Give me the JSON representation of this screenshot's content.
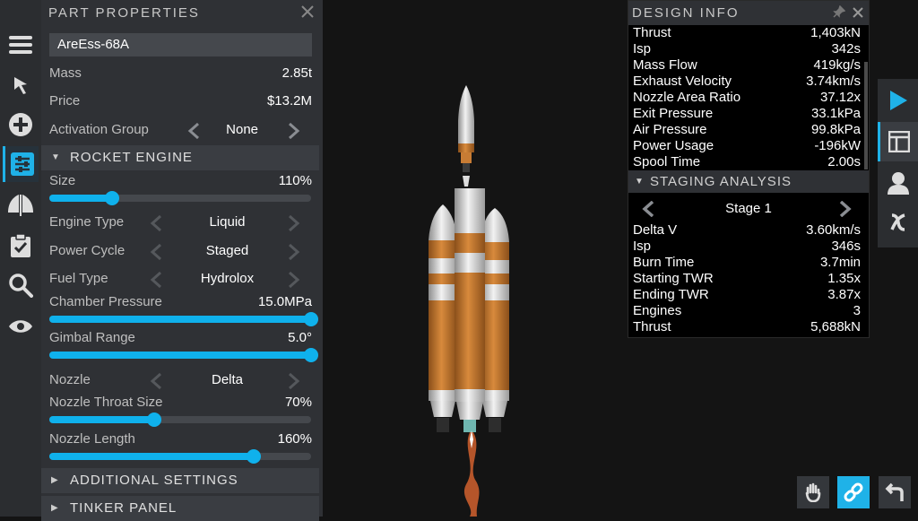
{
  "toolbar": {
    "icons": [
      "menu-icon",
      "cursor-icon",
      "add-part-icon",
      "part-properties-icon",
      "symmetry-icon",
      "checklist-icon",
      "search-icon",
      "visibility-icon"
    ]
  },
  "part_properties": {
    "title": "PART PROPERTIES",
    "part_name": "AreEss-68A",
    "mass_label": "Mass",
    "mass_value": "2.85t",
    "price_label": "Price",
    "price_value": "$13.2M",
    "activation_label": "Activation Group",
    "activation_value": "None",
    "rocket_engine_title": "ROCKET ENGINE",
    "size_label": "Size",
    "size_value": "110%",
    "size_level": 0.24,
    "engine_type_label": "Engine Type",
    "engine_type_value": "Liquid",
    "power_cycle_label": "Power Cycle",
    "power_cycle_value": "Staged",
    "fuel_type_label": "Fuel Type",
    "fuel_type_value": "Hydrolox",
    "chamber_label": "Chamber Pressure",
    "chamber_value": "15.0MPa",
    "chamber_level": 1.0,
    "gimbal_label": "Gimbal Range",
    "gimbal_value": "5.0°",
    "gimbal_level": 1.0,
    "nozzle_label": "Nozzle",
    "nozzle_value": "Delta",
    "throat_label": "Nozzle Throat Size",
    "throat_value": "70%",
    "throat_level": 0.4,
    "length_label": "Nozzle Length",
    "length_value": "160%",
    "length_level": 0.78,
    "additional_title": "ADDITIONAL SETTINGS",
    "tinker_title": "TINKER PANEL"
  },
  "design_info": {
    "title": "DESIGN INFO",
    "rows": [
      {
        "label": "Thrust",
        "value": "1,403kN"
      },
      {
        "label": "Isp",
        "value": "342s"
      },
      {
        "label": "Mass Flow",
        "value": "419kg/s"
      },
      {
        "label": "Exhaust Velocity",
        "value": "3.74km/s"
      },
      {
        "label": "Nozzle Area Ratio",
        "value": "37.12x"
      },
      {
        "label": "Exit Pressure",
        "value": "33.1kPa"
      },
      {
        "label": "Air Pressure",
        "value": "99.8kPa"
      },
      {
        "label": "Power Usage",
        "value": "-196kW"
      },
      {
        "label": "Spool Time",
        "value": "2.00s"
      }
    ],
    "staging_title": "STAGING ANALYSIS",
    "stage_name": "Stage 1",
    "stage_rows": [
      {
        "label": "Delta V",
        "value": "3.60km/s"
      },
      {
        "label": "Isp",
        "value": "346s"
      },
      {
        "label": "Burn Time",
        "value": "3.7min"
      },
      {
        "label": "Starting TWR",
        "value": "1.35x"
      },
      {
        "label": "Ending TWR",
        "value": "3.87x"
      },
      {
        "label": "Engines",
        "value": "3"
      },
      {
        "label": "Thrust",
        "value": "5,688kN"
      }
    ]
  },
  "colors": {
    "accent": "#0fb1ec",
    "panel": "#2f3135",
    "rocket_orange": "#c7782f"
  }
}
